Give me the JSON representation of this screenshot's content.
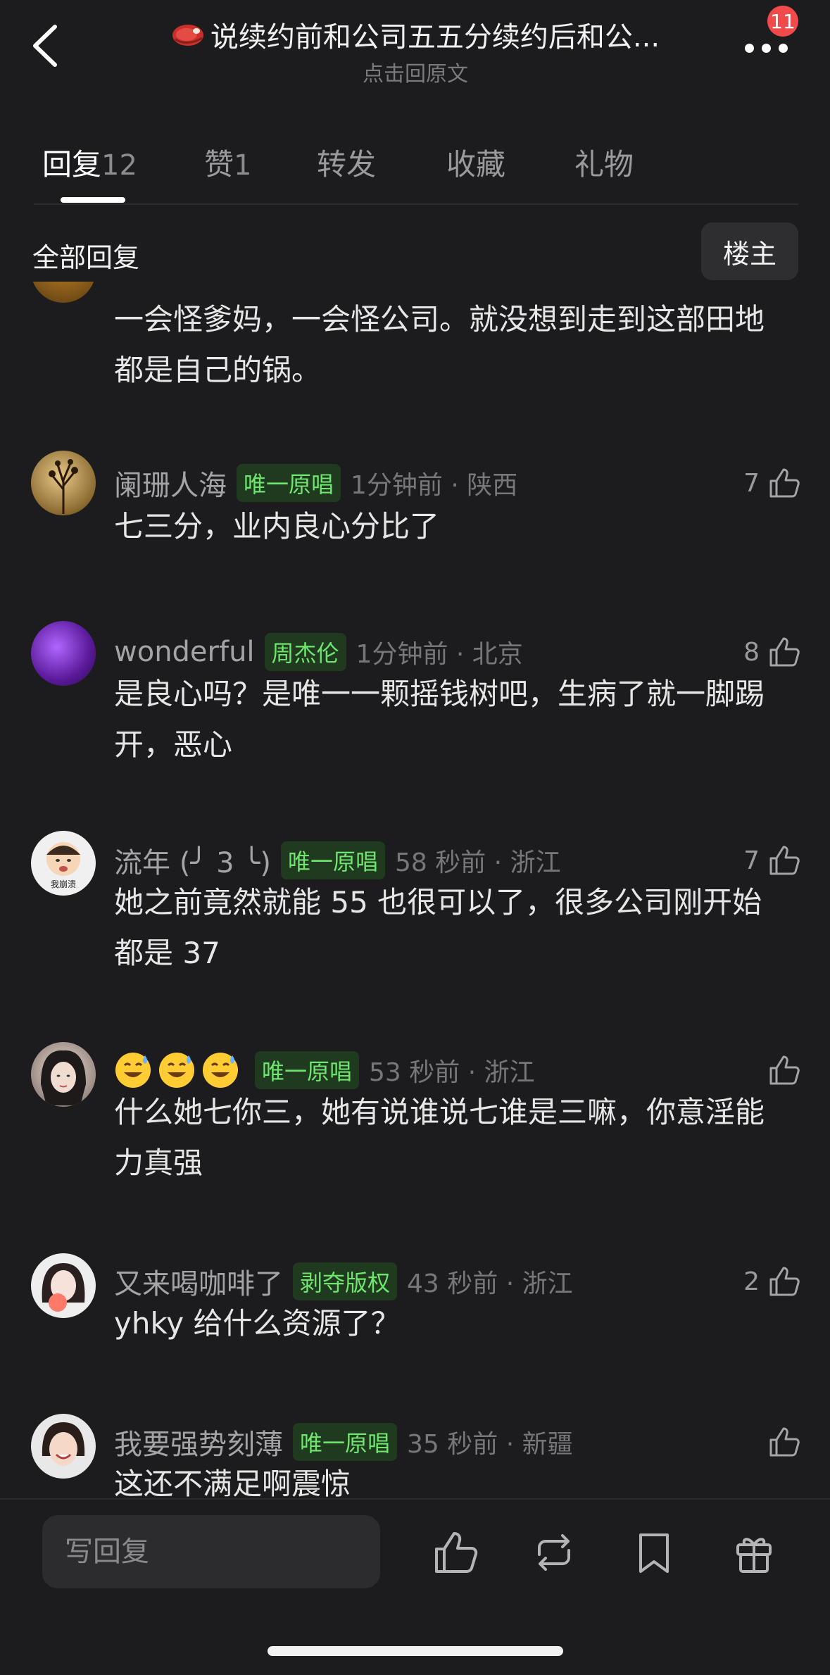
{
  "header": {
    "title": "说续约前和公司五五分续约后和公...",
    "subtitle": "点击回原文",
    "notification_count": "11",
    "icons": {
      "back": "chevron-left-icon",
      "more": "more-dots-icon",
      "title_emoji": "meat-icon"
    }
  },
  "tabs": [
    {
      "label": "回复",
      "count": "12",
      "active": true
    },
    {
      "label": "赞",
      "count": "1",
      "active": false
    },
    {
      "label": "转发",
      "count": "",
      "active": false
    },
    {
      "label": "收藏",
      "count": "",
      "active": false
    },
    {
      "label": "礼物",
      "count": "",
      "active": false
    }
  ],
  "section": {
    "title": "全部回复",
    "op_button": "楼主"
  },
  "comments": [
    {
      "name": "",
      "tag": "",
      "meta": "",
      "likes": "",
      "text": "一会怪爹妈，一会怪公司。就没想到走到这部田地都是自己的锅。",
      "avatar": "avatar-partial"
    },
    {
      "name": "阑珊人海",
      "tag": "唯一原唱",
      "meta": "1分钟前 · 陕西",
      "likes": "7",
      "text": "七三分，业内良心分比了",
      "avatar": "plant-silhouette"
    },
    {
      "name": "wonderful",
      "tag": "周杰伦",
      "meta": "1分钟前 · 北京",
      "likes": "8",
      "text": "是良心吗？是唯一一颗摇钱树吧，生病了就一脚踢开，恶心",
      "avatar": "purple-glitter"
    },
    {
      "name": "流年 (╯ 3 ╰)",
      "tag": "唯一原唱",
      "meta": "58 秒前 · 浙江",
      "likes": "7",
      "text": "她之前竟然就能 55 也很可以了，很多公司刚开始都是 37",
      "avatar": "crying-baby",
      "avatar_text": "我崩溃"
    },
    {
      "name": "",
      "tag": "唯一原唱",
      "meta": "53 秒前 · 浙江",
      "likes": "",
      "text": "什么她七你三，她有说谁说七谁是三嘛，你意淫能力真强",
      "avatar": "girl-portrait",
      "name_emojis": [
        "sweat-smile-emoji",
        "sweat-smile-emoji",
        "sweat-smile-emoji"
      ]
    },
    {
      "name": "又来喝咖啡了",
      "tag": "剥夺版权",
      "meta": "43 秒前 · 浙江",
      "likes": "2",
      "text": "yhky 给什么资源了？",
      "avatar": "girl-with-peach"
    },
    {
      "name": "我要强势刻薄",
      "tag": "唯一原唱",
      "meta": "35 秒前 · 新疆",
      "likes": "",
      "text": "这还不满足啊震惊",
      "avatar": "smiling-woman"
    }
  ],
  "bottom_bar": {
    "reply_placeholder": "写回复",
    "icons": [
      "thumbs-up-icon",
      "repost-icon",
      "bookmark-icon",
      "gift-icon"
    ]
  }
}
